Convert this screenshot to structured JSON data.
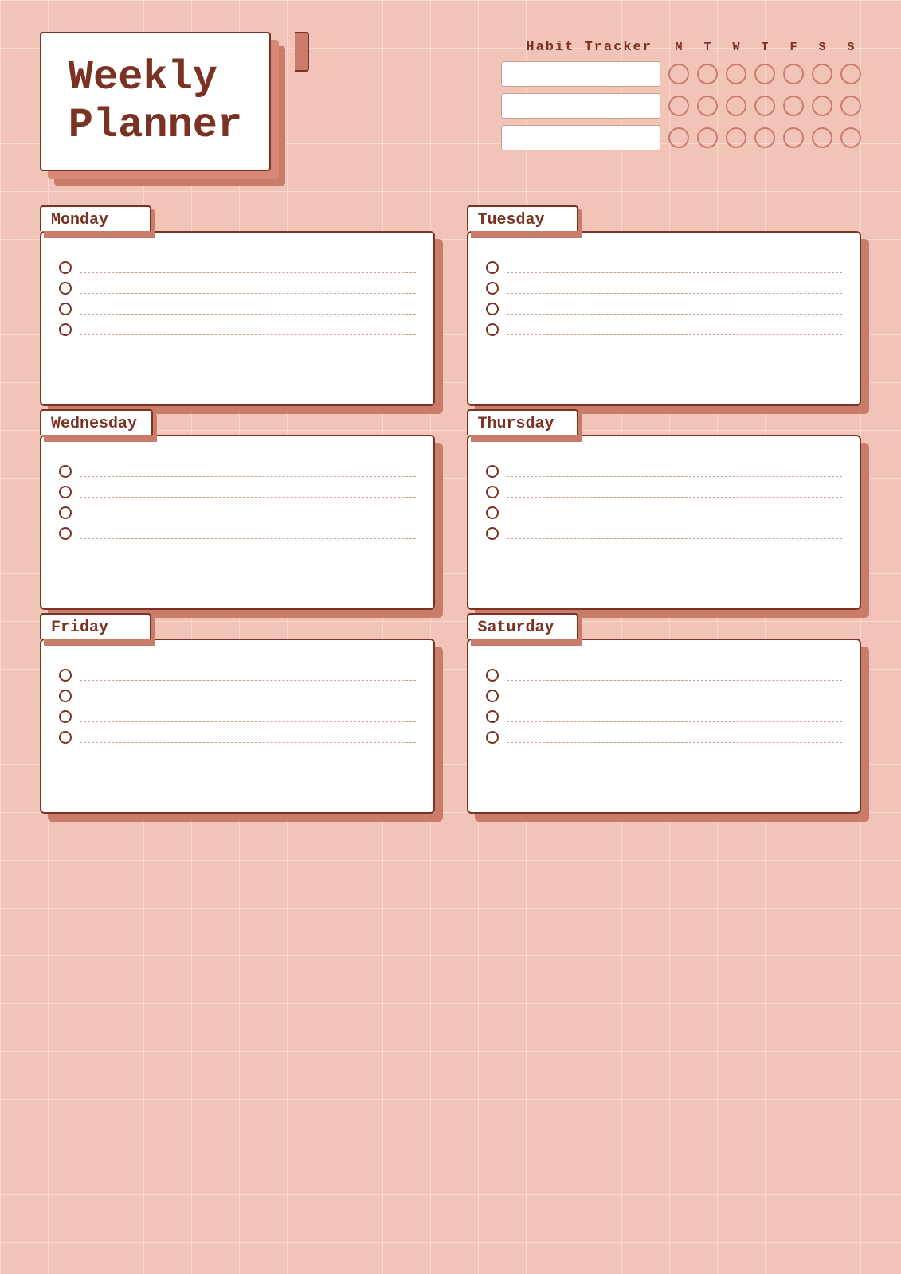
{
  "title": {
    "line1": "Weekly",
    "line2": "Planner"
  },
  "habit_tracker": {
    "label": "Habit Tracker",
    "days": [
      "M",
      "T",
      "W",
      "T",
      "F",
      "S",
      "S"
    ],
    "rows": [
      {
        "id": 1
      },
      {
        "id": 2
      },
      {
        "id": 3
      }
    ]
  },
  "days": [
    {
      "name": "Monday",
      "tasks": 4
    },
    {
      "name": "Tuesday",
      "tasks": 4
    },
    {
      "name": "Wednesday",
      "tasks": 4
    },
    {
      "name": "Thursday",
      "tasks": 4
    },
    {
      "name": "Friday",
      "tasks": 4
    },
    {
      "name": "Saturday",
      "tasks": 4
    }
  ]
}
